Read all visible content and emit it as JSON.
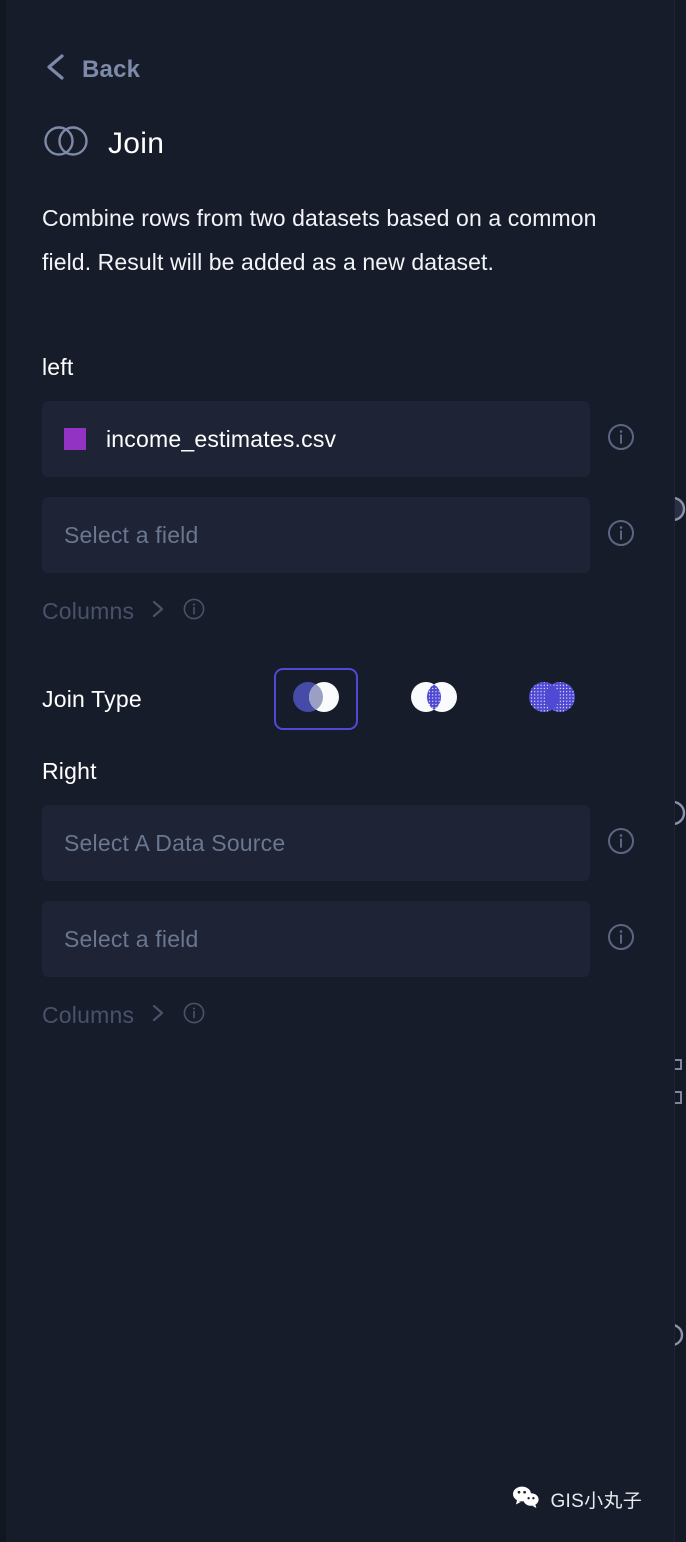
{
  "nav": {
    "back_label": "Back",
    "back_icon": "chevron-left-icon"
  },
  "header": {
    "title": "Join",
    "icon": "venn-circles-icon",
    "description": "Combine rows from two datasets based on a common field. Result will be added as a new dataset."
  },
  "left": {
    "heading": "left",
    "dataset": {
      "value": "income_estimates.csv",
      "swatch_color": "#9333c4",
      "info_icon": "info-icon"
    },
    "field": {
      "placeholder": "Select a field",
      "value": "",
      "info_icon": "info-icon"
    },
    "columns": {
      "label": "Columns",
      "chevron_icon": "chevron-right-icon",
      "info_icon": "info-icon"
    }
  },
  "join_type": {
    "label": "Join Type",
    "selected_index": 0,
    "options": [
      {
        "name": "left-join",
        "icon": "venn-left-join-icon",
        "selected": true
      },
      {
        "name": "inner-join",
        "icon": "venn-inner-join-icon",
        "selected": false
      },
      {
        "name": "outer-join",
        "icon": "venn-outer-join-icon",
        "selected": false
      }
    ]
  },
  "right": {
    "heading": "Right",
    "datasource": {
      "placeholder": "Select A Data Source",
      "value": "",
      "info_icon": "info-icon"
    },
    "field": {
      "placeholder": "Select a field",
      "value": "",
      "info_icon": "info-icon"
    },
    "columns": {
      "label": "Columns",
      "chevron_icon": "chevron-right-icon",
      "info_icon": "info-icon"
    }
  },
  "watermark": {
    "text": "GIS小丸子",
    "icon": "wechat-icon"
  },
  "theme": {
    "background": "#171c2a",
    "field_background": "#1e2335",
    "accent": "#4f49d4",
    "muted_text": "#6a7790",
    "dim_text": "#49526a",
    "back_text": "#7d8aa8",
    "primary_text": "#ffffff"
  }
}
